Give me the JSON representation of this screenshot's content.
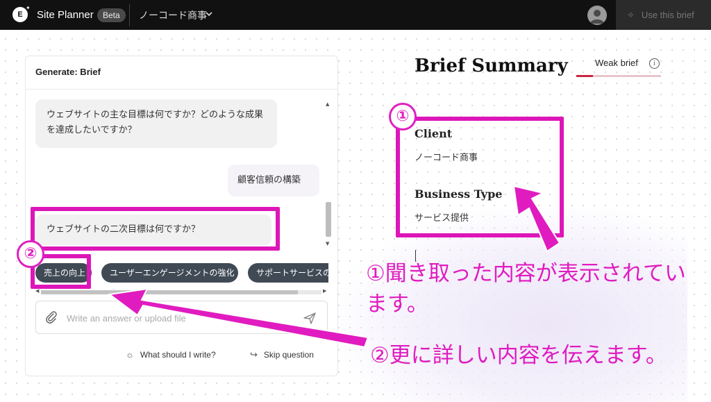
{
  "topbar": {
    "logo": "E",
    "app_name": "Site Planner",
    "badge": "Beta",
    "project_name": "ノーコード商事",
    "use_brief_label": "Use this brief"
  },
  "chat": {
    "title": "Generate: Brief",
    "messages": [
      {
        "role": "assistant",
        "text": "ウェブサイトの主な目標は何ですか？どのような成果を達成したいですか？"
      },
      {
        "role": "user",
        "text": "顧客信頼の構築"
      },
      {
        "role": "assistant",
        "text": "ウェブサイトの二次目標は何ですか？"
      }
    ],
    "suggestions": [
      "売上の向上",
      "ユーザーエンゲージメントの強化",
      "サポートサービスの"
    ],
    "input_placeholder": "Write an answer or upload file",
    "help_label": "What should I write?",
    "skip_label": "Skip question"
  },
  "brief": {
    "title": "Brief Summary",
    "strength_label": "Weak brief",
    "strength_fraction": 0.2,
    "fields": [
      {
        "label": "Client",
        "value": "ノーコード商事"
      },
      {
        "label": "Business Type",
        "value": "サービス提供"
      }
    ]
  },
  "annotations": {
    "marker_1": "①",
    "marker_2": "②",
    "note_1": "①聞き取った内容が表示されています。",
    "note_2": "②更に詳しい内容を伝えます。"
  },
  "colors": {
    "accent_magenta": "#dd16b8",
    "chip_bg": "#3f4a55",
    "weak_bar": "#cc2244",
    "topbar_bg": "#111111"
  },
  "icons": [
    "elementor-logo-icon",
    "chevron-down-icon",
    "user-avatar-icon",
    "sparkle-icon",
    "info-icon",
    "paperclip-icon",
    "send-icon",
    "lightbulb-icon",
    "skip-arrow-icon"
  ]
}
